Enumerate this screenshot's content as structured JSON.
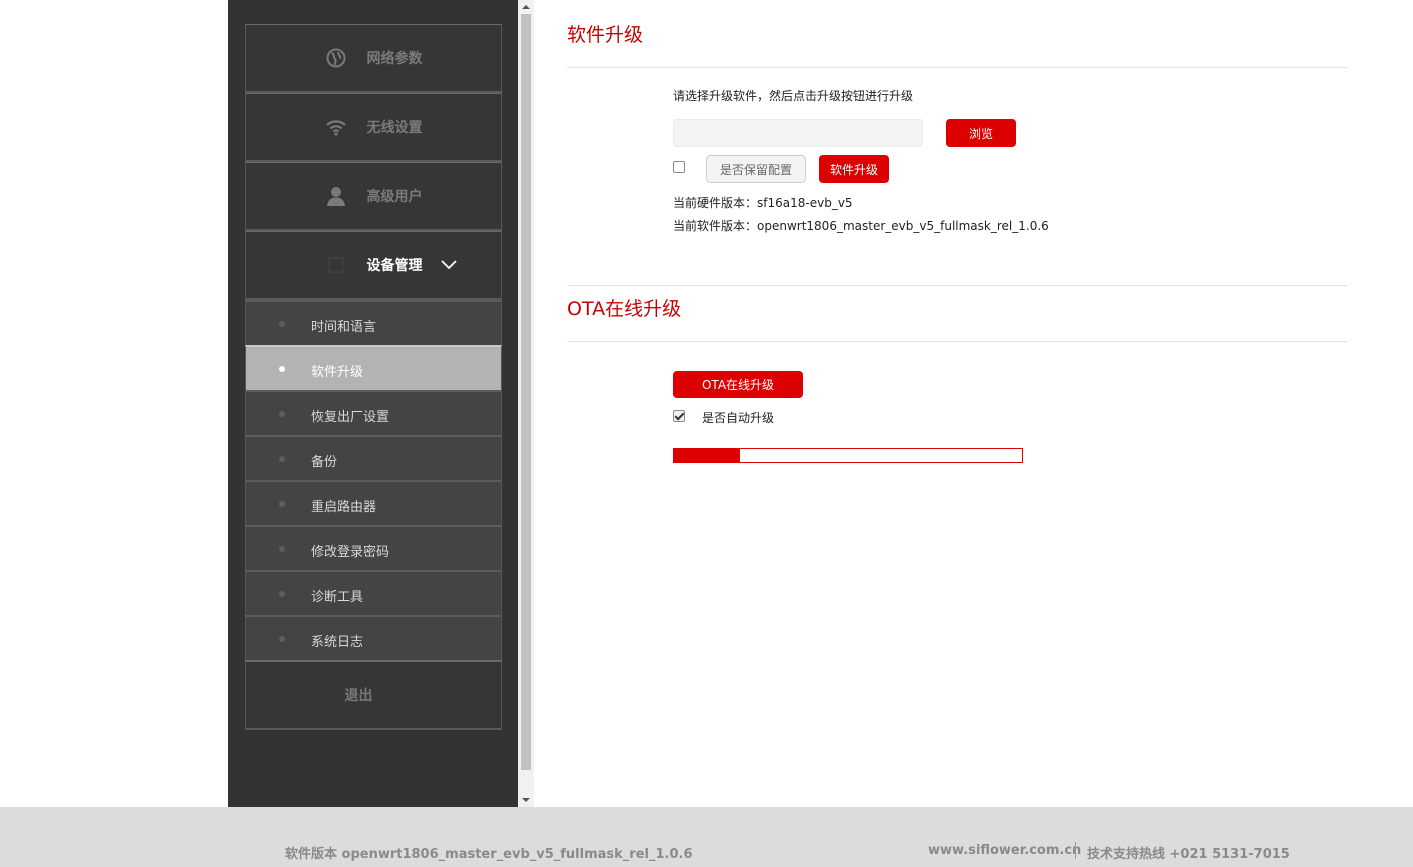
{
  "sidebar": {
    "top_items": [
      {
        "label": "网络参数",
        "icon": "globe-icon"
      },
      {
        "label": "无线设置",
        "icon": "wifi-icon"
      },
      {
        "label": "高级用户",
        "icon": "user-icon"
      }
    ],
    "active_group": {
      "label": "设备管理",
      "icon": "device-icon",
      "expanded": true
    },
    "sub_items": [
      {
        "label": "时间和语言",
        "active": false
      },
      {
        "label": "软件升级",
        "active": true
      },
      {
        "label": "恢复出厂设置",
        "active": false
      },
      {
        "label": "备份",
        "active": false
      },
      {
        "label": "重启路由器",
        "active": false
      },
      {
        "label": "修改登录密码",
        "active": false
      },
      {
        "label": "诊断工具",
        "active": false
      },
      {
        "label": "系统日志",
        "active": false
      }
    ],
    "logout_label": "退出"
  },
  "upgrade": {
    "title": "软件升级",
    "instruction": "请选择升级软件，然后点击升级按钮进行升级",
    "browse_label": "浏览",
    "keep_config_checked": false,
    "keep_config_label": "是否保留配置",
    "upgrade_label": "软件升级",
    "hw_version_label": "当前硬件版本：",
    "hw_version": "sf16a18-evb_v5",
    "sw_version_label": "当前软件版本：",
    "sw_version": "openwrt1806_master_evb_v5_fullmask_rel_1.0.6"
  },
  "ota": {
    "title": "OTA在线升级",
    "button_label": "OTA在线升级",
    "auto_upgrade_checked": true,
    "auto_upgrade_label": "是否自动升级",
    "progress": 0.19
  },
  "footer": {
    "version_text": "软件版本 openwrt1806_master_evb_v5_fullmask_rel_1.0.6",
    "website": "www.siflower.com.cn",
    "hotline": "技术支持热线 +021 5131-7015"
  },
  "colors": {
    "accent": "#dd0000",
    "sidebar_bg": "#333333",
    "active_sub_bg": "#b3b3b3"
  }
}
